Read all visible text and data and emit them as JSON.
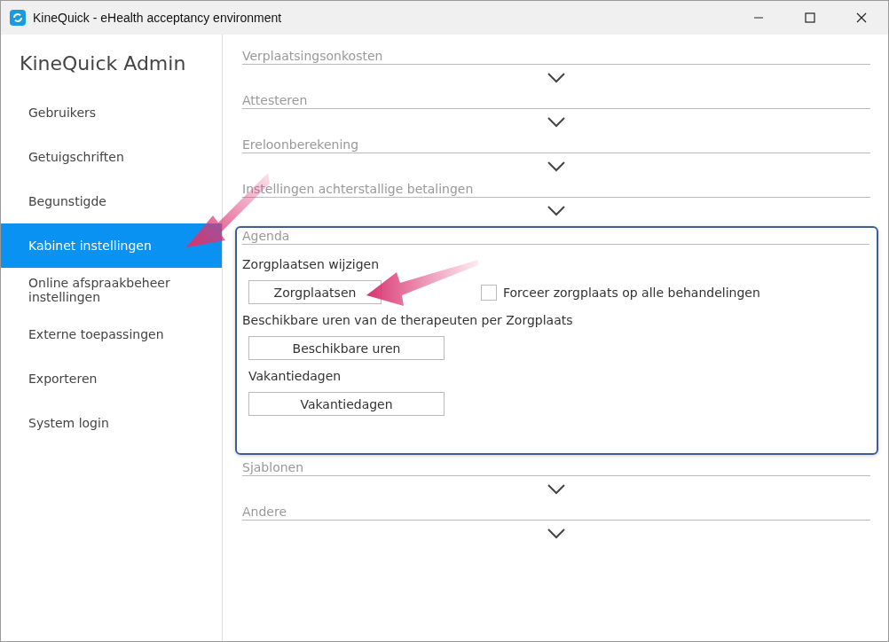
{
  "window": {
    "title": "KineQuick - eHealth acceptancy environment"
  },
  "sidebar": {
    "title": "KineQuick Admin",
    "items": [
      {
        "label": "Gebruikers",
        "selected": false
      },
      {
        "label": "Getuigschriften",
        "selected": false
      },
      {
        "label": "Begunstigde",
        "selected": false
      },
      {
        "label": "Kabinet instellingen",
        "selected": true
      },
      {
        "label": "Online afspraakbeheer instellingen",
        "selected": false
      },
      {
        "label": "Externe toepassingen",
        "selected": false
      },
      {
        "label": "Exporteren",
        "selected": false
      },
      {
        "label": "System login",
        "selected": false
      }
    ]
  },
  "sections": [
    {
      "title": "Verplaatsingsonkosten",
      "expanded": false
    },
    {
      "title": "Attesteren",
      "expanded": false
    },
    {
      "title": "Ereloonberekening",
      "expanded": false
    },
    {
      "title": "Instellingen achterstallige betalingen",
      "expanded": false
    },
    {
      "title": "Agenda",
      "expanded": true,
      "groups": [
        {
          "label": "Zorgplaatsen wijzigen",
          "button": "Zorgplaatsen",
          "checkbox": {
            "label": "Forceer zorgplaats op alle behandelingen",
            "checked": false
          }
        },
        {
          "label": "Beschikbare uren van de therapeuten per Zorgplaats",
          "button": "Beschikbare uren"
        },
        {
          "label": "Vakantiedagen",
          "button": "Vakantiedagen"
        }
      ]
    },
    {
      "title": "Sjablonen",
      "expanded": false
    },
    {
      "title": "Andere",
      "expanded": false
    }
  ]
}
